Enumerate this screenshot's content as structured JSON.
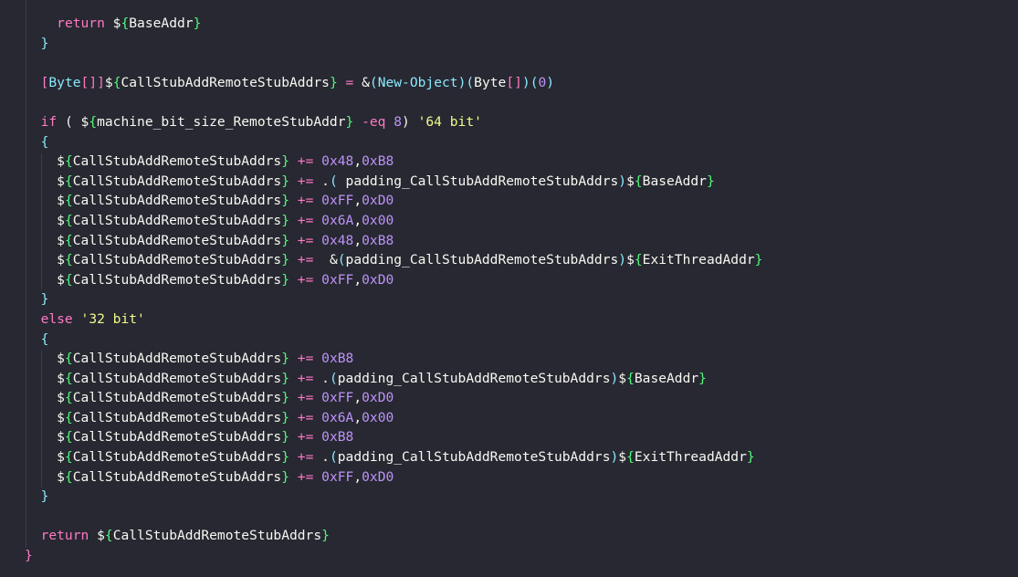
{
  "editor": {
    "language": "powershell",
    "colors": {
      "background": "#272831",
      "keyword": "#ff79c6",
      "operator": "#ff79c6",
      "brace": "#50fa7b",
      "variable": "#f8f8f2",
      "number": "#bd93f9",
      "string": "#f1fa8c",
      "type": "#8be9fd",
      "block_brace": "#8be9fd",
      "outer_brace": "#ff79c6"
    },
    "lines": [
      [
        {
          "t": "    "
        },
        {
          "t": "return",
          "c": "kw"
        },
        {
          "t": " "
        },
        {
          "t": "$",
          "c": "pl"
        },
        {
          "t": "{",
          "c": "br"
        },
        {
          "t": "BaseAddr",
          "c": "var"
        },
        {
          "t": "}",
          "c": "br"
        }
      ],
      [
        {
          "t": "  "
        },
        {
          "t": "}",
          "c": "cbr"
        }
      ],
      [
        {
          "t": ""
        }
      ],
      [
        {
          "t": "  "
        },
        {
          "t": "[",
          "c": "sqb"
        },
        {
          "t": "Byte",
          "c": "type"
        },
        {
          "t": "[]]",
          "c": "sqb"
        },
        {
          "t": "$",
          "c": "pl"
        },
        {
          "t": "{",
          "c": "br"
        },
        {
          "t": "CallStubAddRemoteStubAddrs",
          "c": "var"
        },
        {
          "t": "}",
          "c": "br"
        },
        {
          "t": " "
        },
        {
          "t": "=",
          "c": "op"
        },
        {
          "t": " &",
          "c": "pl"
        },
        {
          "t": "(",
          "c": "pct"
        },
        {
          "t": "New-Object",
          "c": "type"
        },
        {
          "t": ")",
          "c": "pct"
        },
        {
          "t": "(",
          "c": "pct"
        },
        {
          "t": "Byte",
          "c": "pl"
        },
        {
          "t": "[]",
          "c": "sqb"
        },
        {
          "t": ")",
          "c": "pct"
        },
        {
          "t": "(",
          "c": "pct"
        },
        {
          "t": "0",
          "c": "num"
        },
        {
          "t": ")",
          "c": "pct"
        }
      ],
      [
        {
          "t": ""
        }
      ],
      [
        {
          "t": "  "
        },
        {
          "t": "if",
          "c": "kw"
        },
        {
          "t": " ( "
        },
        {
          "t": "$",
          "c": "pl"
        },
        {
          "t": "{",
          "c": "br"
        },
        {
          "t": "machine_bit_size_RemoteStubAddr",
          "c": "var"
        },
        {
          "t": "}",
          "c": "br"
        },
        {
          "t": " "
        },
        {
          "t": "-eq",
          "c": "op"
        },
        {
          "t": " "
        },
        {
          "t": "8",
          "c": "num"
        },
        {
          "t": ") "
        },
        {
          "t": "'64 bit'",
          "c": "str"
        }
      ],
      [
        {
          "t": "  "
        },
        {
          "t": "{",
          "c": "cbr"
        }
      ],
      [
        {
          "t": "    "
        },
        {
          "t": "$",
          "c": "pl"
        },
        {
          "t": "{",
          "c": "br"
        },
        {
          "t": "CallStubAddRemoteStubAddrs",
          "c": "var"
        },
        {
          "t": "}",
          "c": "br"
        },
        {
          "t": " "
        },
        {
          "t": "+=",
          "c": "op"
        },
        {
          "t": " "
        },
        {
          "t": "0x48",
          "c": "num"
        },
        {
          "t": ","
        },
        {
          "t": "0xB8",
          "c": "num"
        }
      ],
      [
        {
          "t": "    "
        },
        {
          "t": "$",
          "c": "pl"
        },
        {
          "t": "{",
          "c": "br"
        },
        {
          "t": "CallStubAddRemoteStubAddrs",
          "c": "var"
        },
        {
          "t": "}",
          "c": "br"
        },
        {
          "t": " "
        },
        {
          "t": "+=",
          "c": "op"
        },
        {
          "t": " ."
        },
        {
          "t": "(",
          "c": "pct"
        },
        {
          "t": " padding_CallStubAddRemoteStubAddrs"
        },
        {
          "t": ")",
          "c": "pct"
        },
        {
          "t": "$",
          "c": "pl"
        },
        {
          "t": "{",
          "c": "br"
        },
        {
          "t": "BaseAddr",
          "c": "var"
        },
        {
          "t": "}",
          "c": "br"
        }
      ],
      [
        {
          "t": "    "
        },
        {
          "t": "$",
          "c": "pl"
        },
        {
          "t": "{",
          "c": "br"
        },
        {
          "t": "CallStubAddRemoteStubAddrs",
          "c": "var"
        },
        {
          "t": "}",
          "c": "br"
        },
        {
          "t": " "
        },
        {
          "t": "+=",
          "c": "op"
        },
        {
          "t": " "
        },
        {
          "t": "0xFF",
          "c": "num"
        },
        {
          "t": ","
        },
        {
          "t": "0xD0",
          "c": "num"
        }
      ],
      [
        {
          "t": "    "
        },
        {
          "t": "$",
          "c": "pl"
        },
        {
          "t": "{",
          "c": "br"
        },
        {
          "t": "CallStubAddRemoteStubAddrs",
          "c": "var"
        },
        {
          "t": "}",
          "c": "br"
        },
        {
          "t": " "
        },
        {
          "t": "+=",
          "c": "op"
        },
        {
          "t": " "
        },
        {
          "t": "0x6A",
          "c": "num"
        },
        {
          "t": ","
        },
        {
          "t": "0x00",
          "c": "num"
        }
      ],
      [
        {
          "t": "    "
        },
        {
          "t": "$",
          "c": "pl"
        },
        {
          "t": "{",
          "c": "br"
        },
        {
          "t": "CallStubAddRemoteStubAddrs",
          "c": "var"
        },
        {
          "t": "}",
          "c": "br"
        },
        {
          "t": " "
        },
        {
          "t": "+=",
          "c": "op"
        },
        {
          "t": " "
        },
        {
          "t": "0x48",
          "c": "num"
        },
        {
          "t": ","
        },
        {
          "t": "0xB8",
          "c": "num"
        }
      ],
      [
        {
          "t": "    "
        },
        {
          "t": "$",
          "c": "pl"
        },
        {
          "t": "{",
          "c": "br"
        },
        {
          "t": "CallStubAddRemoteStubAddrs",
          "c": "var"
        },
        {
          "t": "}",
          "c": "br"
        },
        {
          "t": " "
        },
        {
          "t": "+=",
          "c": "op"
        },
        {
          "t": "  &"
        },
        {
          "t": "(",
          "c": "pct"
        },
        {
          "t": "padding_CallStubAddRemoteStubAddrs"
        },
        {
          "t": ")",
          "c": "pct"
        },
        {
          "t": "$",
          "c": "pl"
        },
        {
          "t": "{",
          "c": "br"
        },
        {
          "t": "ExitThreadAddr",
          "c": "var"
        },
        {
          "t": "}",
          "c": "br"
        }
      ],
      [
        {
          "t": "    "
        },
        {
          "t": "$",
          "c": "pl"
        },
        {
          "t": "{",
          "c": "br"
        },
        {
          "t": "CallStubAddRemoteStubAddrs",
          "c": "var"
        },
        {
          "t": "}",
          "c": "br"
        },
        {
          "t": " "
        },
        {
          "t": "+=",
          "c": "op"
        },
        {
          "t": " "
        },
        {
          "t": "0xFF",
          "c": "num"
        },
        {
          "t": ","
        },
        {
          "t": "0xD0",
          "c": "num"
        }
      ],
      [
        {
          "t": "  "
        },
        {
          "t": "}",
          "c": "cbr"
        }
      ],
      [
        {
          "t": "  "
        },
        {
          "t": "else",
          "c": "kw"
        },
        {
          "t": " "
        },
        {
          "t": "'32 bit'",
          "c": "str"
        }
      ],
      [
        {
          "t": "  "
        },
        {
          "t": "{",
          "c": "cbr"
        }
      ],
      [
        {
          "t": "    "
        },
        {
          "t": "$",
          "c": "pl"
        },
        {
          "t": "{",
          "c": "br"
        },
        {
          "t": "CallStubAddRemoteStubAddrs",
          "c": "var"
        },
        {
          "t": "}",
          "c": "br"
        },
        {
          "t": " "
        },
        {
          "t": "+=",
          "c": "op"
        },
        {
          "t": " "
        },
        {
          "t": "0xB8",
          "c": "num"
        }
      ],
      [
        {
          "t": "    "
        },
        {
          "t": "$",
          "c": "pl"
        },
        {
          "t": "{",
          "c": "br"
        },
        {
          "t": "CallStubAddRemoteStubAddrs",
          "c": "var"
        },
        {
          "t": "}",
          "c": "br"
        },
        {
          "t": " "
        },
        {
          "t": "+=",
          "c": "op"
        },
        {
          "t": " ."
        },
        {
          "t": "(",
          "c": "pct"
        },
        {
          "t": "padding_CallStubAddRemoteStubAddrs"
        },
        {
          "t": ")",
          "c": "pct"
        },
        {
          "t": "$",
          "c": "pl"
        },
        {
          "t": "{",
          "c": "br"
        },
        {
          "t": "BaseAddr",
          "c": "var"
        },
        {
          "t": "}",
          "c": "br"
        }
      ],
      [
        {
          "t": "    "
        },
        {
          "t": "$",
          "c": "pl"
        },
        {
          "t": "{",
          "c": "br"
        },
        {
          "t": "CallStubAddRemoteStubAddrs",
          "c": "var"
        },
        {
          "t": "}",
          "c": "br"
        },
        {
          "t": " "
        },
        {
          "t": "+=",
          "c": "op"
        },
        {
          "t": " "
        },
        {
          "t": "0xFF",
          "c": "num"
        },
        {
          "t": ","
        },
        {
          "t": "0xD0",
          "c": "num"
        }
      ],
      [
        {
          "t": "    "
        },
        {
          "t": "$",
          "c": "pl"
        },
        {
          "t": "{",
          "c": "br"
        },
        {
          "t": "CallStubAddRemoteStubAddrs",
          "c": "var"
        },
        {
          "t": "}",
          "c": "br"
        },
        {
          "t": " "
        },
        {
          "t": "+=",
          "c": "op"
        },
        {
          "t": " "
        },
        {
          "t": "0x6A",
          "c": "num"
        },
        {
          "t": ","
        },
        {
          "t": "0x00",
          "c": "num"
        }
      ],
      [
        {
          "t": "    "
        },
        {
          "t": "$",
          "c": "pl"
        },
        {
          "t": "{",
          "c": "br"
        },
        {
          "t": "CallStubAddRemoteStubAddrs",
          "c": "var"
        },
        {
          "t": "}",
          "c": "br"
        },
        {
          "t": " "
        },
        {
          "t": "+=",
          "c": "op"
        },
        {
          "t": " "
        },
        {
          "t": "0xB8",
          "c": "num"
        }
      ],
      [
        {
          "t": "    "
        },
        {
          "t": "$",
          "c": "pl"
        },
        {
          "t": "{",
          "c": "br"
        },
        {
          "t": "CallStubAddRemoteStubAddrs",
          "c": "var"
        },
        {
          "t": "}",
          "c": "br"
        },
        {
          "t": " "
        },
        {
          "t": "+=",
          "c": "op"
        },
        {
          "t": " ."
        },
        {
          "t": "(",
          "c": "pct"
        },
        {
          "t": "padding_CallStubAddRemoteStubAddrs"
        },
        {
          "t": ")",
          "c": "pct"
        },
        {
          "t": "$",
          "c": "pl"
        },
        {
          "t": "{",
          "c": "br"
        },
        {
          "t": "ExitThreadAddr",
          "c": "var"
        },
        {
          "t": "}",
          "c": "br"
        }
      ],
      [
        {
          "t": "    "
        },
        {
          "t": "$",
          "c": "pl"
        },
        {
          "t": "{",
          "c": "br"
        },
        {
          "t": "CallStubAddRemoteStubAddrs",
          "c": "var"
        },
        {
          "t": "}",
          "c": "br"
        },
        {
          "t": " "
        },
        {
          "t": "+=",
          "c": "op"
        },
        {
          "t": " "
        },
        {
          "t": "0xFF",
          "c": "num"
        },
        {
          "t": ","
        },
        {
          "t": "0xD0",
          "c": "num"
        }
      ],
      [
        {
          "t": "  "
        },
        {
          "t": "}",
          "c": "cbr"
        }
      ],
      [
        {
          "t": ""
        }
      ],
      [
        {
          "t": "  "
        },
        {
          "t": "return",
          "c": "kw"
        },
        {
          "t": " "
        },
        {
          "t": "$",
          "c": "pl"
        },
        {
          "t": "{",
          "c": "br"
        },
        {
          "t": "CallStubAddRemoteStubAddrs",
          "c": "var"
        },
        {
          "t": "}",
          "c": "br"
        }
      ],
      [
        {
          "t": "}",
          "c": "ob"
        }
      ]
    ]
  }
}
